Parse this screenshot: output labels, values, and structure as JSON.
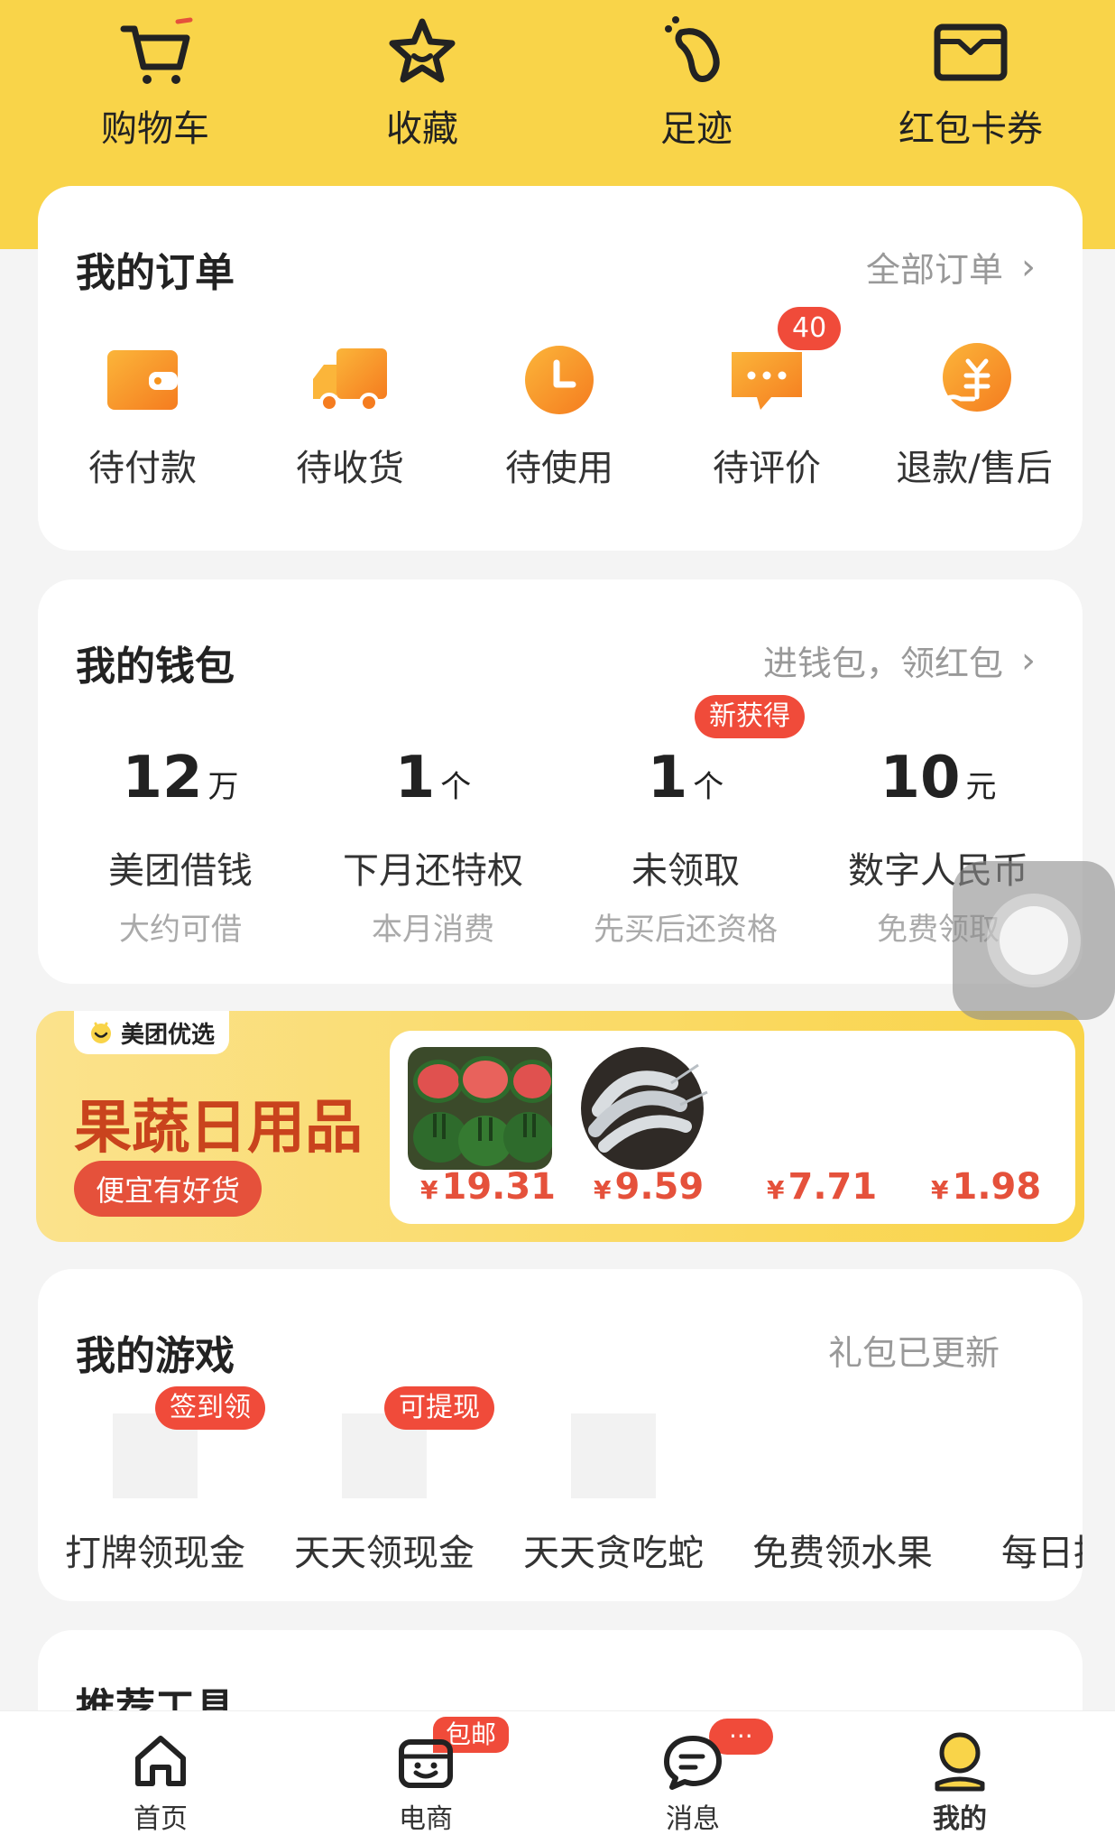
{
  "quick_links": [
    {
      "label": "购物车",
      "icon": "cart-icon"
    },
    {
      "label": "收藏",
      "icon": "star-icon"
    },
    {
      "label": "足迹",
      "icon": "footprint-icon"
    },
    {
      "label": "红包卡券",
      "icon": "coupon-icon"
    }
  ],
  "orders": {
    "title": "我的订单",
    "all_link": "全部订单",
    "items": [
      {
        "label": "待付款",
        "icon": "wallet-icon"
      },
      {
        "label": "待收货",
        "icon": "truck-icon"
      },
      {
        "label": "待使用",
        "icon": "clock-icon"
      },
      {
        "label": "待评价",
        "icon": "comment-icon",
        "badge": "40"
      },
      {
        "label": "退款/售后",
        "icon": "refund-icon"
      }
    ]
  },
  "wallet": {
    "title": "我的钱包",
    "link": "进钱包，领红包",
    "items": [
      {
        "value": "12",
        "unit": "万",
        "title": "美团借钱",
        "sub": "大约可借"
      },
      {
        "value": "1",
        "unit": "个",
        "title": "下月还特权",
        "sub": "本月消费"
      },
      {
        "value": "1",
        "unit": "个",
        "title": "未领取",
        "sub": "先买后还资格",
        "badge": "新获得"
      },
      {
        "value": "10",
        "unit": "元",
        "title": "数字人民币",
        "sub": "免费领取"
      }
    ]
  },
  "promo": {
    "brand": "美团优选",
    "title": "果蔬日用品",
    "button": "便宜有好货",
    "yen": "¥",
    "prices": [
      "19.31",
      "9.59",
      "7.71",
      "1.98"
    ]
  },
  "games": {
    "title": "我的游戏",
    "link": "礼包已更新",
    "items": [
      {
        "label": "打牌领现金",
        "badge": "签到领"
      },
      {
        "label": "天天领现金",
        "badge": "可提现"
      },
      {
        "label": "天天贪吃蛇"
      },
      {
        "label": "免费领水果"
      },
      {
        "label": "每日推"
      }
    ]
  },
  "tools": {
    "title": "推荐工具"
  },
  "nav": {
    "items": [
      {
        "label": "首页",
        "icon": "home-icon"
      },
      {
        "label": "电商",
        "icon": "shop-icon",
        "badge": "包邮"
      },
      {
        "label": "消息",
        "icon": "message-icon",
        "badge": "···"
      },
      {
        "label": "我的",
        "icon": "profile-icon",
        "active": true
      }
    ]
  },
  "colors": {
    "brand_yellow": "#f9d449",
    "badge_red": "#f04b3a",
    "orange": "#f7a21b"
  }
}
